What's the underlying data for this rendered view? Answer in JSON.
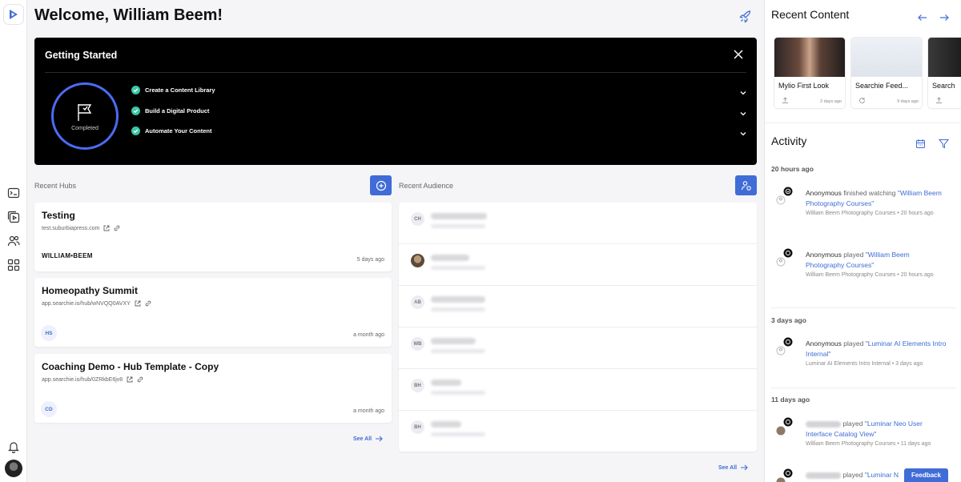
{
  "header": {
    "welcome": "Welcome, William Beem!"
  },
  "getting_started": {
    "title": "Getting Started",
    "status": "Completed",
    "steps": [
      {
        "label": "Create a Content Library"
      },
      {
        "label": "Build a Digital Product"
      },
      {
        "label": "Automate Your Content"
      }
    ]
  },
  "hubs": {
    "label": "Recent Hubs",
    "see_all": "See All",
    "items": [
      {
        "name": "Testing",
        "url": "test.suburbiapress.com",
        "logo": "WILLIAM•BEEM",
        "age": "5 days ago"
      },
      {
        "name": "Homeopathy Summit",
        "url": "app.searchie.io/hub/wNVQQ0AVXY",
        "badge": "HS",
        "age": "a month ago"
      },
      {
        "name": "Coaching Demo - Hub Template - Copy",
        "url": "app.searchie.io/hub/0ZRkbE6jv8",
        "badge": "CD",
        "age": "a month ago"
      }
    ]
  },
  "audience": {
    "label": "Recent Audience",
    "see_all": "See All",
    "rows": [
      {
        "initials": "CH"
      },
      {
        "initials": ""
      },
      {
        "initials": "AB"
      },
      {
        "initials": "WB"
      },
      {
        "initials": "BH"
      },
      {
        "initials": "BH"
      }
    ]
  },
  "recent_content": {
    "title": "Recent Content",
    "cards": [
      {
        "title": "Mylio First Look",
        "date": "2 days ago"
      },
      {
        "title": "Searchie Feed...",
        "date": "9 days ago"
      },
      {
        "title": "Search"
      }
    ]
  },
  "activity": {
    "title": "Activity",
    "groups": [
      {
        "ago": "20 hours ago",
        "events": [
          {
            "who": "Anonymous",
            "action": "finished watching",
            "item": "\"William Beem Photography Courses\"",
            "meta": "William Beem Photography Courses • 20 hours ago"
          },
          {
            "who": "Anonymous",
            "action": "played",
            "item": "\"William Beem Photography Courses\"",
            "meta": "William Beem Photography Courses • 20 hours ago"
          }
        ]
      },
      {
        "ago": "3 days ago",
        "events": [
          {
            "who": "Anonymous",
            "action": "played",
            "item": "\"Luminar AI Elements Intro Internal\"",
            "meta": "Luminar AI Elements Intro Internal • 3 days ago"
          }
        ]
      },
      {
        "ago": "11 days ago",
        "events": [
          {
            "who": "",
            "action": "played",
            "item": "\"Luminar Neo User Interface Catalog View\"",
            "meta": "William Beem Photography Courses • 11 days ago"
          },
          {
            "who": "",
            "action": "played",
            "item": "\"Luminar N",
            "meta": ""
          }
        ]
      }
    ]
  },
  "feedback": "Feedback",
  "colors": {
    "accent": "#3f6cd6",
    "check": "#3bc6a4",
    "ring": "#4a6cf7"
  }
}
